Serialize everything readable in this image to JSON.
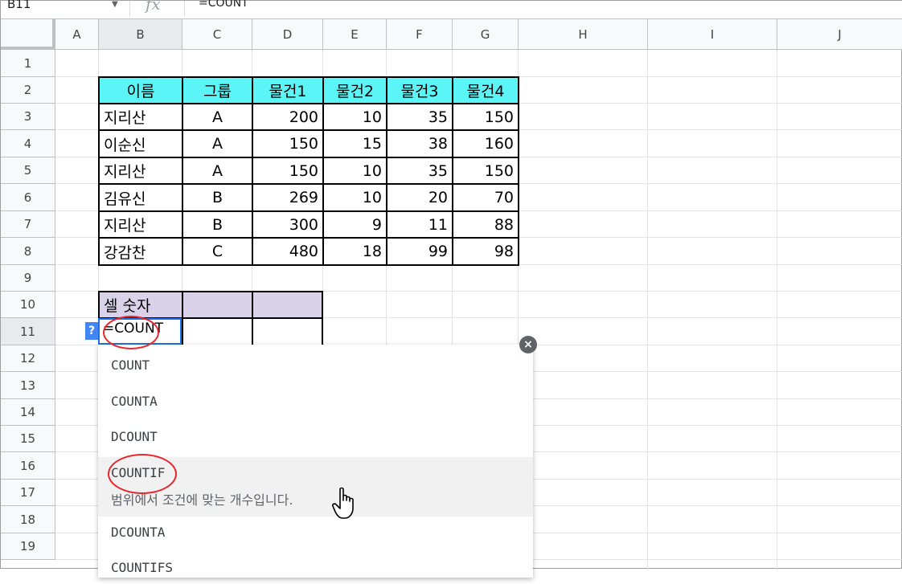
{
  "formula_bar": {
    "name_box": "B11",
    "fx": "fx",
    "formula": "=COUNT"
  },
  "columns": [
    "A",
    "B",
    "C",
    "D",
    "E",
    "F",
    "G",
    "H",
    "I",
    "J"
  ],
  "rows": [
    "1",
    "2",
    "3",
    "4",
    "5",
    "6",
    "7",
    "8",
    "9",
    "10",
    "11",
    "12",
    "13",
    "14",
    "15",
    "16",
    "17",
    "18",
    "19"
  ],
  "table": {
    "headers": [
      "이름",
      "그룹",
      "물건1",
      "물건2",
      "물건3",
      "물건4"
    ],
    "rows": [
      [
        "지리산",
        "A",
        "200",
        "10",
        "35",
        "150"
      ],
      [
        "이순신",
        "A",
        "150",
        "15",
        "38",
        "160"
      ],
      [
        "지리산",
        "A",
        "150",
        "10",
        "35",
        "150"
      ],
      [
        "김유신",
        "B",
        "269",
        "10",
        "20",
        "70"
      ],
      [
        "지리산",
        "B",
        "300",
        "9",
        "11",
        "88"
      ],
      [
        "강감찬",
        "C",
        "480",
        "18",
        "99",
        "98"
      ]
    ]
  },
  "count_label": "셀 숫자",
  "active_cell_text": "=COUNT",
  "help_badge": "?",
  "autocomplete": {
    "items": [
      {
        "name": "COUNT"
      },
      {
        "name": "COUNTA"
      },
      {
        "name": "DCOUNT"
      },
      {
        "name": "COUNTIF",
        "description": "범위에서 조건에 맞는 개수입니다."
      },
      {
        "name": "DCOUNTA"
      },
      {
        "name": "COUNTIFS"
      }
    ],
    "close_symbol": "×"
  },
  "colors": {
    "header_fill": "#5cf5f7",
    "label_fill": "#d9d2e9",
    "annotation": "#e8262b",
    "selection": "#1a73e8"
  }
}
